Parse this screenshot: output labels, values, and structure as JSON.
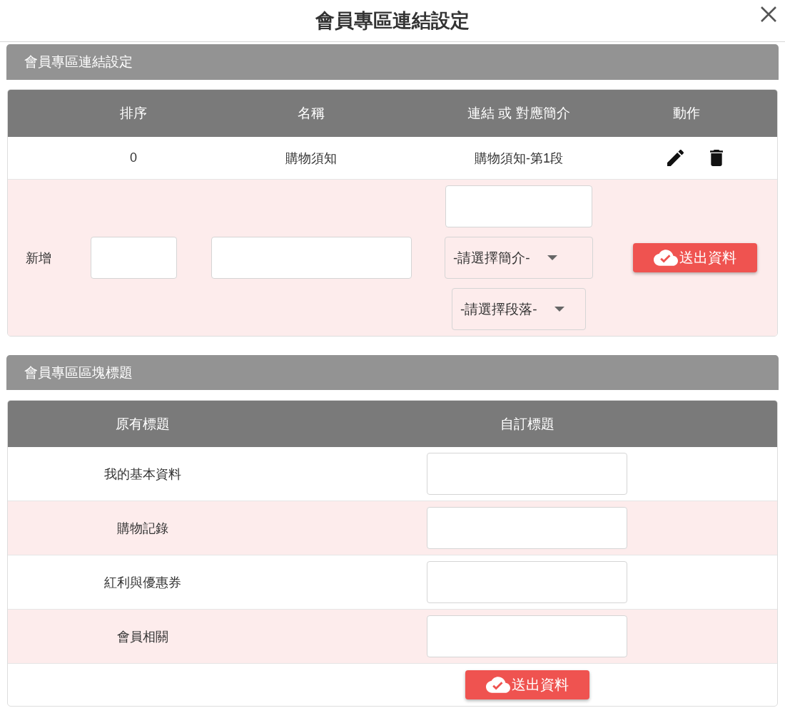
{
  "dialog": {
    "title": "會員專區連結設定"
  },
  "link_section": {
    "title": "會員專區連結設定",
    "columns": [
      "排序",
      "名稱",
      "連結 或 對應簡介",
      "動作"
    ],
    "rows": [
      {
        "order": "0",
        "name": "購物須知",
        "link": "購物須知-第1段"
      }
    ],
    "new_row": {
      "label": "新增",
      "intro_select": "-請選擇簡介-",
      "paragraph_select": "-請選擇段落-",
      "submit": "送出資料"
    }
  },
  "block_section": {
    "title": "會員專區區塊標題",
    "columns": [
      "原有標題",
      "自訂標題"
    ],
    "rows": [
      {
        "original": "我的基本資料"
      },
      {
        "original": "購物記錄"
      },
      {
        "original": "紅利與優惠券"
      },
      {
        "original": "會員相關"
      }
    ],
    "submit": "送出資料"
  }
}
